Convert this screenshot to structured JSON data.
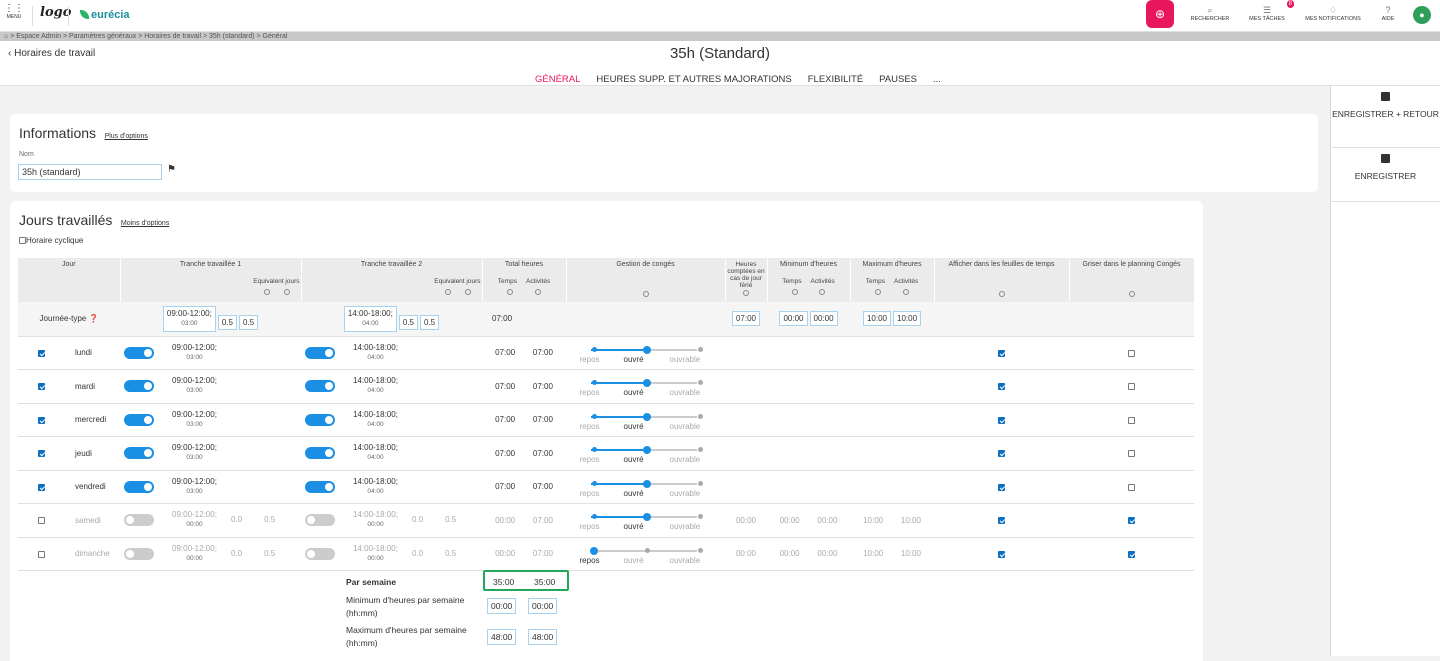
{
  "topbar": {
    "menu_label": "MENU",
    "logo_text": "logo",
    "brand": "eurécia",
    "actions": [
      {
        "label": "RECHERCHER",
        "icon": "search-icon"
      },
      {
        "label": "MES TÂCHES",
        "icon": "tasks-icon",
        "badge": "8"
      },
      {
        "label": "MES NOTIFICATIONS",
        "icon": "bell-icon"
      },
      {
        "label": "AIDE",
        "icon": "help-icon"
      }
    ]
  },
  "breadcrumb": "> Espace Admin > Paramètres généraux > Horaires de travail > 35h (standard) > Général",
  "header": {
    "back_label": "Horaires de travail",
    "title": "35h (Standard)",
    "tabs": [
      "GÉNÉRAL",
      "HEURES SUPP. ET AUTRES MAJORATIONS",
      "FLEXIBILITÉ",
      "PAUSES",
      "..."
    ]
  },
  "sidebar": {
    "save_return": "ENREGISTRER + RETOUR",
    "save": "ENREGISTRER"
  },
  "info": {
    "title": "Informations",
    "more_options": "Plus d'options",
    "name_label": "Nom",
    "name_value": "35h (standard)"
  },
  "jours": {
    "title": "Jours travaillés",
    "less_options": "Moins d'options",
    "cyclic_label": "Horaire cyclique",
    "headers": {
      "jour": "Jour",
      "tranche1": "Tranche travaillée 1",
      "tranche2": "Tranche travaillée 2",
      "equiv": "Equivalent jours",
      "total": "Total heures",
      "temps": "Temps",
      "activites": "Activités",
      "conges": "Gestion de congés",
      "ferie": "Heures comptées en cas de jour férié",
      "min": "Minimum d'heures",
      "max": "Maximum d'heures",
      "afficher": "Afficher dans les feuilles de temps",
      "griser": "Griser dans le planning Congés"
    },
    "typical": {
      "label": "Journée-type",
      "t1": "09:00-12:00;",
      "t1_dur": "03:00",
      "e1a": "0.5",
      "e1b": "0.5",
      "t2": "14:00-18:00;",
      "t2_dur": "04:00",
      "e2a": "0.5",
      "e2b": "0.5",
      "total": "07:00",
      "ferie": "07:00",
      "min_t": "00:00",
      "min_a": "00:00",
      "max_t": "10:00",
      "max_a": "10:00"
    },
    "slider_labels": [
      "repos",
      "ouvré",
      "ouvrable"
    ],
    "days": [
      {
        "name": "lundi",
        "on": true,
        "t1": "09:00-12:00;",
        "t1d": "03:00",
        "t2": "14:00-18:00;",
        "t2d": "04:00",
        "temps": "07:00",
        "act": "07:00",
        "state": 1,
        "afficher": true,
        "griser": false
      },
      {
        "name": "mardi",
        "on": true,
        "t1": "09:00-12:00;",
        "t1d": "03:00",
        "t2": "14:00-18:00;",
        "t2d": "04:00",
        "temps": "07:00",
        "act": "07:00",
        "state": 1,
        "afficher": true,
        "griser": false
      },
      {
        "name": "mercredi",
        "on": true,
        "t1": "09:00-12:00;",
        "t1d": "03:00",
        "t2": "14:00-18:00;",
        "t2d": "04:00",
        "temps": "07:00",
        "act": "07:00",
        "state": 1,
        "afficher": true,
        "griser": false
      },
      {
        "name": "jeudi",
        "on": true,
        "t1": "09:00-12:00;",
        "t1d": "03:00",
        "t2": "14:00-18:00;",
        "t2d": "04:00",
        "temps": "07:00",
        "act": "07:00",
        "state": 1,
        "afficher": true,
        "griser": false
      },
      {
        "name": "vendredi",
        "on": true,
        "t1": "09:00-12:00;",
        "t1d": "03:00",
        "t2": "14:00-18:00;",
        "t2d": "04:00",
        "temps": "07:00",
        "act": "07:00",
        "state": 1,
        "afficher": true,
        "griser": false
      },
      {
        "name": "samedi",
        "on": false,
        "t1": "09:00-12:00;",
        "t1d": "00:00",
        "e1a": "0.0",
        "e1b": "0.5",
        "t2": "14:00-18:00;",
        "t2d": "00:00",
        "e2a": "0.0",
        "e2b": "0.5",
        "temps": "00:00",
        "act": "07:00",
        "state": 1,
        "ferie": "00:00",
        "min_t": "00:00",
        "min_a": "00:00",
        "max_t": "10:00",
        "max_a": "10:00",
        "afficher": true,
        "griser": true
      },
      {
        "name": "dimanche",
        "on": false,
        "t1": "09:00-12:00;",
        "t1d": "00:00",
        "e1a": "0.0",
        "e1b": "0.5",
        "t2": "14:00-18:00;",
        "t2d": "00:00",
        "e2a": "0.0",
        "e2b": "0.5",
        "temps": "00:00",
        "act": "07:00",
        "state": 0,
        "ferie": "00:00",
        "min_t": "00:00",
        "min_a": "00:00",
        "max_t": "10:00",
        "max_a": "10:00",
        "afficher": true,
        "griser": true
      }
    ],
    "totals": {
      "par_semaine": "Par semaine",
      "ps_t": "35:00",
      "ps_a": "35:00",
      "min_label": "Minimum d'heures par semaine (hh:mm)",
      "min_t": "00:00",
      "min_a": "00:00",
      "max_label": "Maximum d'heures par semaine (hh:mm)",
      "max_t": "48:00",
      "max_a": "48:00"
    }
  },
  "colors": {
    "accent": "#e8175d",
    "primary": "#1a8fe3",
    "highlight": "#22a85a"
  }
}
